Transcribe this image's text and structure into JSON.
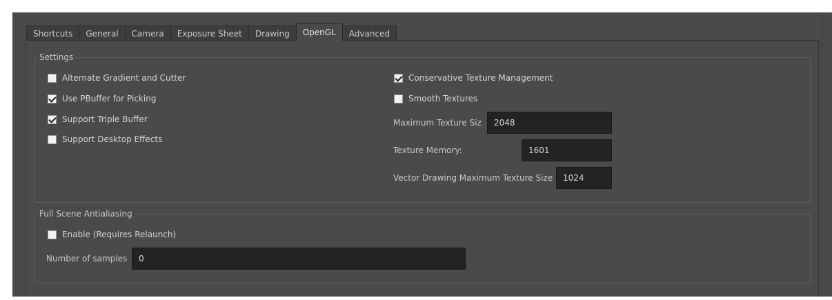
{
  "tabs": [
    {
      "label": "Shortcuts"
    },
    {
      "label": "General"
    },
    {
      "label": "Camera"
    },
    {
      "label": "Exposure Sheet"
    },
    {
      "label": "Drawing"
    },
    {
      "label": "OpenGL",
      "active": true
    },
    {
      "label": "Advanced"
    }
  ],
  "settings": {
    "title": "Settings",
    "alternate_gradient": {
      "label": "Alternate Gradient and Cutter",
      "checked": false
    },
    "use_pbuffer": {
      "label": "Use PBuffer for Picking",
      "checked": true
    },
    "triple_buffer": {
      "label": "Support Triple Buffer",
      "checked": true
    },
    "desktop_effects": {
      "label": "Support Desktop Effects",
      "checked": false
    },
    "conservative_texture": {
      "label": "Conservative Texture Management",
      "checked": true
    },
    "smooth_textures": {
      "label": "Smooth Textures",
      "checked": false
    },
    "max_texture_size": {
      "label": "Maximum Texture Siz",
      "value": "2048"
    },
    "texture_memory": {
      "label": "Texture Memory:",
      "value": "1601"
    },
    "vector_max_texture": {
      "label": "Vector Drawing Maximum Texture Size",
      "value": "1024"
    }
  },
  "antialiasing": {
    "title": "Full Scene Antialiasing",
    "enable": {
      "label": "Enable (Requires Relaunch)",
      "checked": false
    },
    "samples": {
      "label": "Number of samples",
      "value": "0"
    }
  },
  "colors": {
    "background": "#4a4a4a",
    "field": "#232323",
    "text": "#c8c8c8"
  }
}
